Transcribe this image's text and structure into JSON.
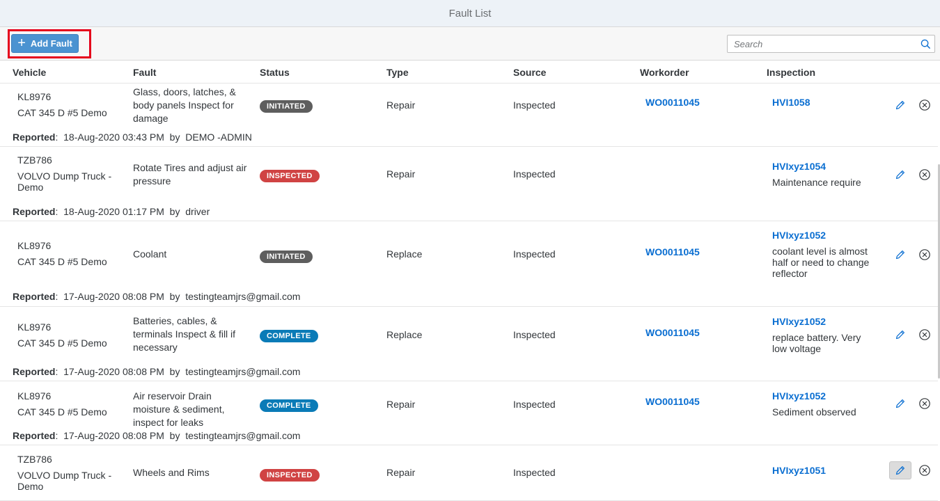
{
  "page": {
    "title": "Fault List"
  },
  "toolbar": {
    "add_label": "Add Fault",
    "search_placeholder": "Search"
  },
  "columns": {
    "vehicle": "Vehicle",
    "fault": "Fault",
    "status": "Status",
    "type": "Type",
    "source": "Source",
    "workorder": "Workorder",
    "inspection": "Inspection"
  },
  "labels": {
    "reported": "Reported",
    "by": "by"
  },
  "colors": {
    "initiated": "#5e5e5e",
    "inspected": "#d04343",
    "complete": "#0a7bb7",
    "link": "#0a6ed1"
  },
  "rows": [
    {
      "vehicle_id": "KL8976",
      "vehicle_name": "CAT 345 D #5 Demo",
      "fault": "Glass, doors, latches, & body panels Inspect for damage",
      "status": "INITIATED",
      "type": "Repair",
      "source": "Inspected",
      "workorder": "WO0011045",
      "inspection": "HVI1058",
      "note": "",
      "reported_date": "18-Aug-2020 03:43 PM",
      "reported_by": "DEMO -ADMIN"
    },
    {
      "vehicle_id": "TZB786",
      "vehicle_name": "VOLVO Dump Truck - Demo",
      "fault": "Rotate Tires and adjust air pressure",
      "status": "INSPECTED",
      "type": "Repair",
      "source": "Inspected",
      "workorder": "",
      "inspection": "HVIxyz1054",
      "note": "Maintenance require",
      "reported_date": "18-Aug-2020 01:17 PM",
      "reported_by": "driver"
    },
    {
      "vehicle_id": "KL8976",
      "vehicle_name": "CAT 345 D #5 Demo",
      "fault": "Coolant",
      "status": "INITIATED",
      "type": "Replace",
      "source": "Inspected",
      "workorder": "WO0011045",
      "inspection": "HVIxyz1052",
      "note": "coolant level is almost half or need to change reflector",
      "reported_date": "17-Aug-2020 08:08 PM",
      "reported_by": "testingteamjrs@gmail.com"
    },
    {
      "vehicle_id": "KL8976",
      "vehicle_name": "CAT 345 D #5 Demo",
      "fault": "Batteries, cables, & terminals Inspect & fill if necessary",
      "status": "COMPLETE",
      "type": "Replace",
      "source": "Inspected",
      "workorder": "WO0011045",
      "inspection": "HVIxyz1052",
      "note": "replace battery. Very low voltage",
      "reported_date": "17-Aug-2020 08:08 PM",
      "reported_by": "testingteamjrs@gmail.com"
    },
    {
      "vehicle_id": "KL8976",
      "vehicle_name": "CAT 345 D #5 Demo",
      "fault": "Air reservoir Drain moisture & sediment, inspect for leaks",
      "status": "COMPLETE",
      "type": "Repair",
      "source": "Inspected",
      "workorder": "WO0011045",
      "inspection": "HVIxyz1052",
      "note": "Sediment observed",
      "reported_date": "17-Aug-2020 08:08 PM",
      "reported_by": "testingteamjrs@gmail.com"
    },
    {
      "vehicle_id": "TZB786",
      "vehicle_name": "VOLVO Dump Truck - Demo",
      "fault": "Wheels and Rims",
      "status": "INSPECTED",
      "type": "Repair",
      "source": "Inspected",
      "workorder": "",
      "inspection": "HVIxyz1051",
      "note": "",
      "reported_date": "",
      "reported_by": ""
    }
  ]
}
